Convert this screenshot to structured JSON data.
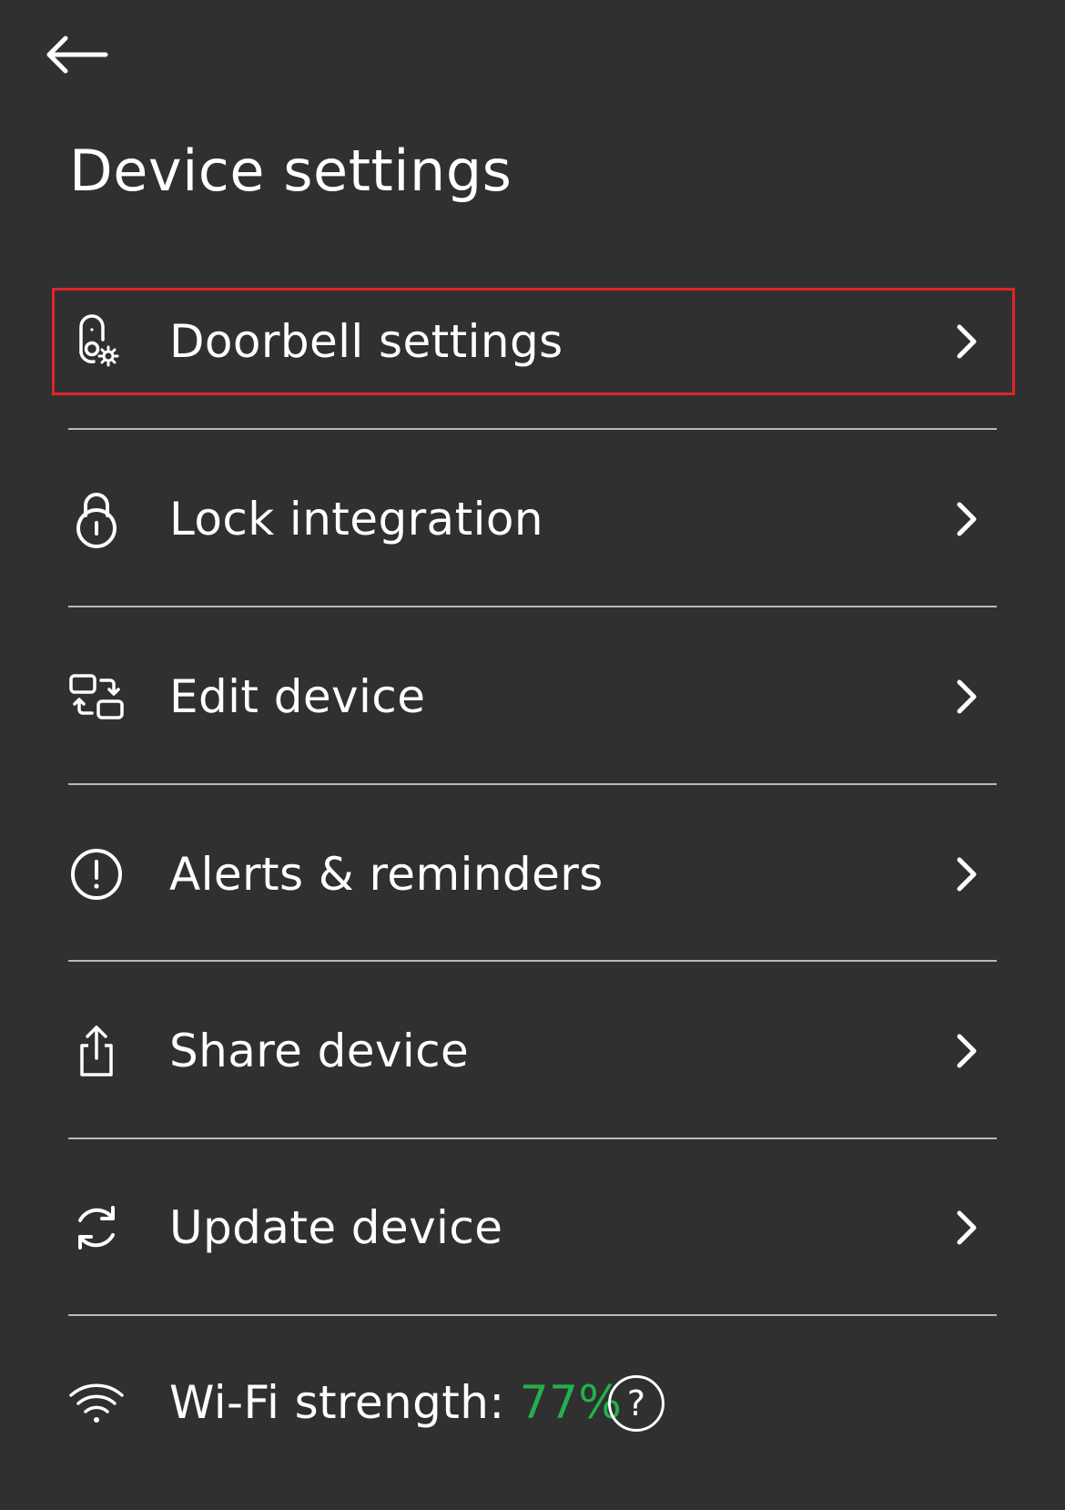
{
  "header": {
    "back_icon": "arrow-left-icon",
    "title": "Device settings"
  },
  "menu": {
    "items": [
      {
        "label": "Doorbell settings",
        "icon": "doorbell-gear-icon",
        "highlighted": true
      },
      {
        "label": "Lock integration",
        "icon": "padlock-icon"
      },
      {
        "label": "Edit device",
        "icon": "swap-devices-icon"
      },
      {
        "label": "Alerts & reminders",
        "icon": "alert-circle-icon"
      },
      {
        "label": "Share device",
        "icon": "share-icon"
      },
      {
        "label": "Update device",
        "icon": "refresh-icon"
      }
    ],
    "chevron_icon": "chevron-right-icon"
  },
  "wifi": {
    "icon": "wifi-icon",
    "label": "Wi-Fi strength:",
    "value": "77%",
    "help_label": "?"
  },
  "colors": {
    "background": "#303030",
    "text": "#ffffff",
    "divider": "#b9b9b9",
    "highlight": "#e0242c",
    "wifi_value": "#22b14c"
  }
}
